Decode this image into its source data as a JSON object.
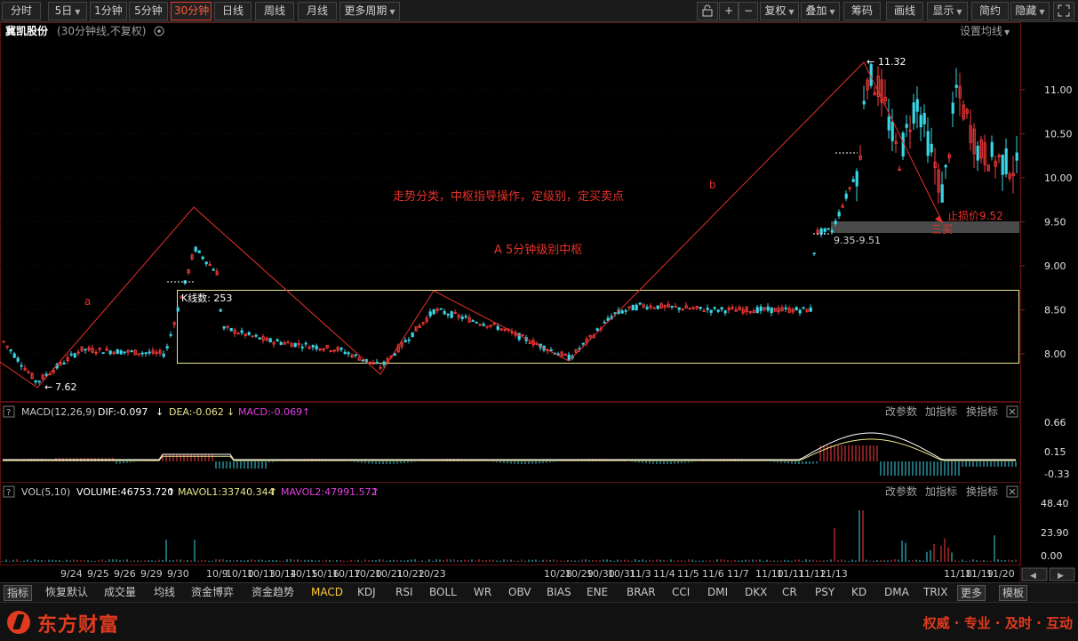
{
  "toolbar": {
    "periods": [
      "分时",
      "5日",
      "1分钟",
      "5分钟",
      "30分钟",
      "日线",
      "周线",
      "月线",
      "更多周期"
    ],
    "active_period": "30分钟",
    "right_buttons": [
      "复权",
      "叠加",
      "筹码",
      "画线",
      "显示",
      "简约",
      "隐藏"
    ]
  },
  "header": {
    "stock_name": "冀凯股份",
    "mode": "(30分钟线,不复权)",
    "set_ma": "设置均线"
  },
  "annotations": {
    "wave_a": "a",
    "wave_b": "b",
    "title_text": "走势分类，中枢指导操作，定级别，定买卖点",
    "zone_label": "A  5分钟级别中枢",
    "kline_count_label": "K线数: 253",
    "stop_loss": "止损价9.52",
    "third_buy": "三买",
    "zone_range": "9.35-9.51",
    "high_label": "11.32",
    "low_label": "7.62"
  },
  "price_axis": [
    "11.00",
    "10.50",
    "10.00",
    "9.50",
    "9.00",
    "8.50",
    "8.00"
  ],
  "macd": {
    "name": "MACD(12,26,9)",
    "dif": "DIF:-0.097",
    "dea": "DEA:-0.062",
    "macd": "MACD:-0.069",
    "axis": [
      "0.66",
      "0.15",
      "-0.33"
    ],
    "links": [
      "改参数",
      "加指标",
      "换指标"
    ]
  },
  "vol": {
    "name": "VOL(5,10)",
    "volume": "VOLUME:46753.720",
    "mavol1": "MAVOL1:33740.344",
    "mavol2": "MAVOL2:47991.572",
    "axis": [
      "48.40",
      "23.90",
      "0.00"
    ],
    "links": [
      "改参数",
      "加指标",
      "换指标"
    ]
  },
  "date_axis": [
    "9/24",
    "9/25",
    "9/26",
    "9/29",
    "9/30",
    "10/9",
    "10/10",
    "10/13",
    "10/14",
    "10/15",
    "10/16",
    "10/17",
    "10/20",
    "10/21",
    "10/22",
    "10/23",
    "10/28",
    "10/29",
    "10/30",
    "10/31",
    "11/3",
    "11/4",
    "11/5",
    "11/6",
    "11/7",
    "11/10",
    "11/11",
    "11/12",
    "11/13",
    "11/18",
    "11/19",
    "11/20"
  ],
  "indicator_tabs": [
    "指标",
    "恢复默认",
    "成交量",
    "均线",
    "资金博弈",
    "资金趋势",
    "MACD",
    "KDJ",
    "RSI",
    "BOLL",
    "WR",
    "OBV",
    "BIAS",
    "ENE",
    "BRAR",
    "CCI",
    "DMI",
    "DKX",
    "CR",
    "PSY",
    "KD",
    "DMA",
    "TRIX",
    "更多",
    "模板"
  ],
  "footer": {
    "brand": "东方财富",
    "slogan": "权威 · 专业 · 及时 · 互动"
  },
  "colors": {
    "up": "#ff3b3b",
    "down": "#39d6e6",
    "box": "#e8e68a",
    "zigzag": "#e8302a",
    "dif": "#ffffff",
    "dea": "#e8e68a",
    "macd_label": "#e040e0"
  }
}
